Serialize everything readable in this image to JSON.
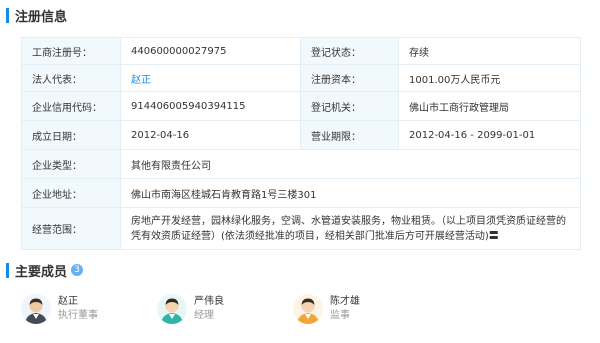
{
  "registration": {
    "title": "注册信息",
    "rows": [
      [
        {
          "label": "工商注册号：",
          "value": "440600000027975"
        },
        {
          "label": "登记状态：",
          "value": "存续"
        }
      ],
      [
        {
          "label": "法人代表：",
          "value": "赵正"
        },
        {
          "label": "注册资本：",
          "value": "1001.00万人民币元"
        }
      ],
      [
        {
          "label": "企业信用代码：",
          "value": "914406005940394115"
        },
        {
          "label": "登记机关：",
          "value": "佛山市工商行政管理局"
        }
      ],
      [
        {
          "label": "成立日期：",
          "value": "2012-04-16"
        },
        {
          "label": "营业期限：",
          "value": "2012-04-16 - 2099-01-01"
        }
      ],
      [
        {
          "label": "企业类型：",
          "value": "其他有限责任公司"
        }
      ],
      [
        {
          "label": "企业地址：",
          "value": "佛山市南海区桂城石肯教育路1号三楼301"
        }
      ],
      [
        {
          "label": "经营范围：",
          "value": "房地产开发经营，园林绿化服务，空调、水管道安装服务，物业租赁。（以上项目须凭资质证经营的凭有效资质证经营）(依法须经批准的项目，经相关部门批准后方可开展经营活动)〓"
        }
      ]
    ]
  },
  "members_section": {
    "title": "主要成员",
    "count": "3",
    "members": [
      {
        "name": "赵正",
        "role": "执行董事",
        "avatar_icon": "man-avatar-icon"
      },
      {
        "name": "严伟良",
        "role": "经理",
        "avatar_icon": "man-avatar-icon"
      },
      {
        "name": "陈才雄",
        "role": "监事",
        "avatar_icon": "man-avatar-icon"
      }
    ]
  },
  "colors": {
    "accent": "#128bed",
    "label_bg": "#f2f9fc",
    "border": "#e4eef6"
  }
}
